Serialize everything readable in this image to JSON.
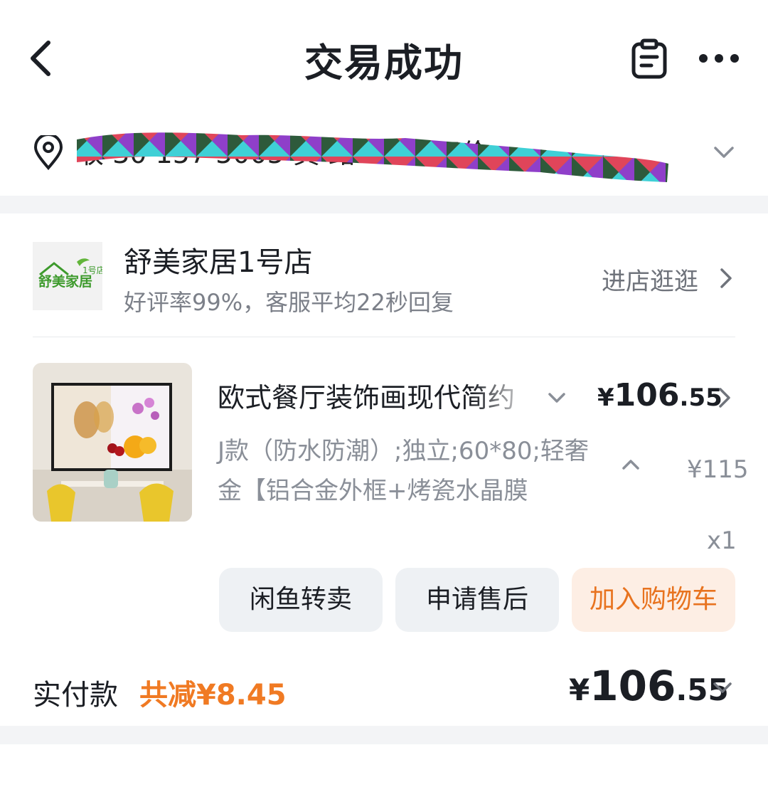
{
  "header": {
    "title": "交易成功",
    "back_icon": "back-arrow-icon",
    "orders_icon": "clipboard-icon",
    "more_icon": "more-dots-icon"
  },
  "address": {
    "pin_icon": "location-pin-icon",
    "text_visible": "收      30  157      5005 黄     路216号天价..",
    "expand_icon": "chevron-down-icon"
  },
  "shop": {
    "logo_text": "1号店 舒美家居",
    "name": "舒美家居1号店",
    "subtitle": "好评率99%，客服平均22秒回复",
    "link_label": "进店逛逛"
  },
  "product": {
    "title": "欧式餐厅装饰画现代简约",
    "spec": "J款（防水防潮）;独立;60*80;轻奢金【铝合金外框+烤瓷水晶膜",
    "price_currency": "¥",
    "price_int": "106",
    "price_dec": ".55",
    "original_price": "¥115",
    "quantity": "x1"
  },
  "actions": {
    "resell": "闲鱼转卖",
    "after_sale": "申请售后",
    "add_cart": "加入购物车"
  },
  "payment": {
    "label": "实付款",
    "discount": "共减¥8.45",
    "total_currency": "¥",
    "total_int": "106",
    "total_dec": ".55"
  },
  "colors": {
    "accent_orange": "#f07a23",
    "button_bg": "#eef1f4",
    "cart_button_bg": "#fdeee4",
    "page_bg": "#f3f4f6"
  }
}
